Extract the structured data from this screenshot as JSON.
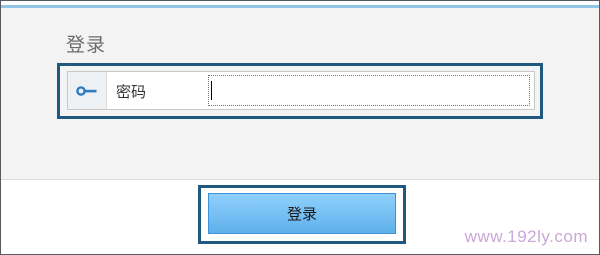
{
  "dialog": {
    "title": "登录",
    "password_label": "密码",
    "password_value": "",
    "submit_label": "登录"
  },
  "watermark": "www.192ly.com",
  "colors": {
    "accent_top_rule": "#8fc6e8",
    "highlight_border": "#1f5a7e",
    "button_fill": "#6cbcf2",
    "watermark": "#c9a9d6"
  },
  "icons": {
    "password": "key-icon"
  }
}
